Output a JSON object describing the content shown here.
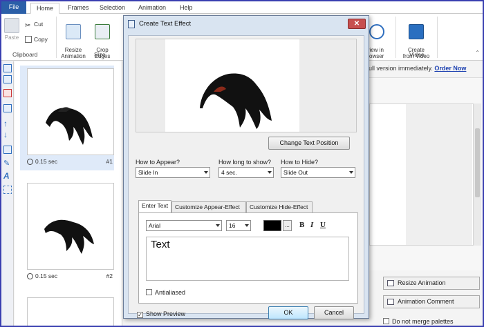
{
  "ribbon": {
    "tabs": [
      "File",
      "Home",
      "Frames",
      "Selection",
      "Animation",
      "Help"
    ],
    "clipboard": {
      "paste": "Paste",
      "cut": "Cut",
      "copy": "Copy",
      "label": "Clipboard"
    },
    "size": {
      "resize": "Resize\nAnimation",
      "crop": "Crop\nEdges",
      "label": "Size"
    },
    "review": {
      "label": "eview in\nBrowser"
    },
    "video": {
      "create": "Create\nfrom Video",
      "label": "Video"
    }
  },
  "notice": {
    "text": "ng full version immediately.",
    "link": "Order Now"
  },
  "frames": [
    {
      "time": "0.15 sec",
      "num": "#1"
    },
    {
      "time": "0.15 sec",
      "num": "#2"
    }
  ],
  "right_panel": {
    "resize_btn": "Resize Animation",
    "comment_btn": "Animation Comment",
    "merge_label": "Do not merge palettes"
  },
  "dialog": {
    "title": "Create Text Effect",
    "close": "✕",
    "change_pos": "Change Text Position",
    "appear_label": "How to Appear?",
    "appear_value": "Slide In",
    "duration_label": "How long to show?",
    "duration_value": "4 sec.",
    "hide_label": "How to Hide?",
    "hide_value": "Slide Out",
    "tabs": [
      "Enter Text",
      "Customize Appear-Effect",
      "Customize Hide-Effect"
    ],
    "font": "Arial",
    "font_size": "16",
    "color": "#000000",
    "dots": "...",
    "bold": "B",
    "italic": "I",
    "underline": "U",
    "text": "Text",
    "antialiased": "Antialiased",
    "show_preview": "Show Preview",
    "ok": "OK",
    "cancel": "Cancel"
  }
}
